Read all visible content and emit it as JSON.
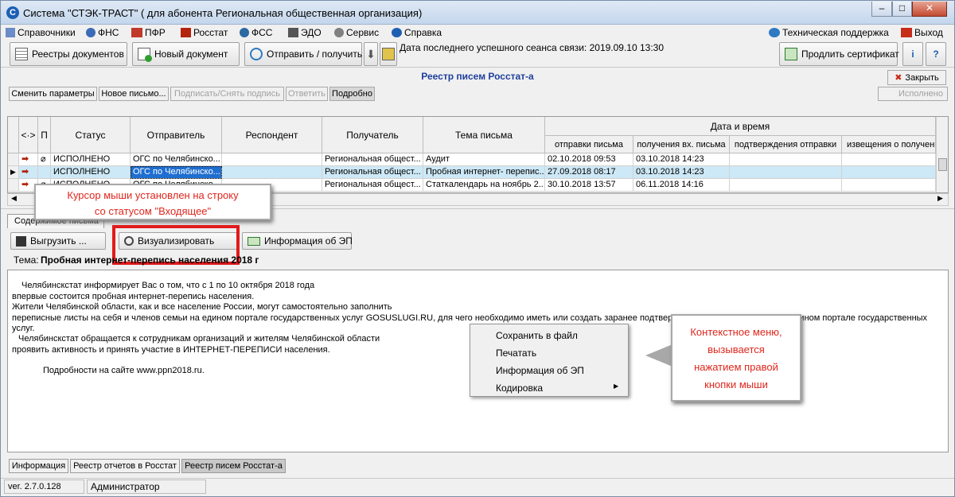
{
  "window": {
    "title": "Система \"СТЭК-ТРАСТ\" ( для абонента Региональная общественная организация)",
    "minimize": "–",
    "maximize": "□",
    "close": "✕"
  },
  "menu": {
    "items": [
      "Справочники",
      "ФНС",
      "ПФР",
      "Росстат",
      "ФСС",
      "ЭДО",
      "Сервис",
      "Справка"
    ],
    "support": "Техническая поддержка",
    "exit": "Выход"
  },
  "toolbar": {
    "registers": "Реестры документов",
    "new_doc": "Новый документ",
    "send_receive": "Отправить / получить",
    "last_session": "Дата последнего успешного сеанса связи: 2019.09.10 13:30",
    "extend_cert": "Продлить сертификат"
  },
  "panel": {
    "title": "Реестр писем Росстат-а",
    "close": "Закрыть",
    "buttons": [
      "Сменить параметры",
      "Новое письмо...",
      "Подписать/Снять подпись",
      "Ответить",
      "Подробно"
    ],
    "status_filter": "Исполнено"
  },
  "grid": {
    "headers": {
      "nav": "<·>",
      "p": "П",
      "status": "Статус",
      "sender": "Отправитель",
      "respondent": "Респондент",
      "recipient": "Получатель",
      "subject": "Тема письма",
      "datetime": "Дата и время",
      "sent": "отправки письма",
      "received": "получения вх. письма",
      "confirm": "подтверждения отправки",
      "notice": "извещения о получени"
    },
    "rows": [
      {
        "status": "ИСПОЛНЕНО",
        "sender": "ОГС по Челябинско...",
        "respondent": "",
        "recipient": "Региональная общест...",
        "subject": "Аудит",
        "sent": "02.10.2018 09:53",
        "received": "03.10.2018 14:23",
        "confirm": "",
        "notice": ""
      },
      {
        "status": "ИСПОЛНЕНО",
        "sender": "ОГС по Челябинско...",
        "respondent": "",
        "recipient": "Региональная общест...",
        "subject": "Пробная интернет- перепис...",
        "sent": "27.09.2018 08:17",
        "received": "03.10.2018 14:23",
        "confirm": "",
        "notice": ""
      },
      {
        "status": "ИСПОЛНЕНО",
        "sender": "ОГС по Челябинско...",
        "respondent": "",
        "recipient": "Региональная общест...",
        "subject": "Статкалендарь на ноябрь 2...",
        "sent": "30.10.2018 13:57",
        "received": "06.11.2018 14:16",
        "confirm": "",
        "notice": ""
      }
    ]
  },
  "callout1": {
    "line1": "Курсор мыши установлен на строку",
    "line2": "со статусом \"Входящее\""
  },
  "content": {
    "tab": "Содержимое письма",
    "export": "Выгрузить ...",
    "visualize": "Визуализировать",
    "ep_info": "Информация об ЭП",
    "subject_label": "Тема:",
    "subject_value": "Пробная интернет-перепись населения 2018 г",
    "body": [
      "Челябинскстат информирует Вас о том, что с 1 по 10 октября 2018 года",
      "впервые состоится пробная интернет-перепись населения.",
      "Жители Челябинской области, как и все население России, могут самостоятельно заполнить",
      "переписные листы на себя и членов семьи на едином портале государственных услуг GOSUSLUGI.RU, для чего необходимо иметь или создать заранее подтверждённую учётную запись на едином портале государственных",
      "услуг.",
      "Челябинскстат обращается к сотрудникам организаций и жителям Челябинской области",
      "проявить активность и принять участие в ИНТЕРНЕТ-ПЕРЕПИСИ населения.",
      "Подробности на сайте www.ppn2018.ru."
    ]
  },
  "context_menu": [
    "Сохранить в файл",
    "Печатать",
    "Информация об ЭП",
    "Кодировка"
  ],
  "callout2": {
    "line1": "Контекстное меню,",
    "line2": "вызывается",
    "line3": "нажатием правой",
    "line4": "кнопки мыши"
  },
  "bottom_tabs": [
    "Информация",
    "Реестр отчетов в Росстат",
    "Реестр писем Росстат-а"
  ],
  "status": {
    "version": "ver. 2.7.0.128",
    "user": "Администратор"
  }
}
